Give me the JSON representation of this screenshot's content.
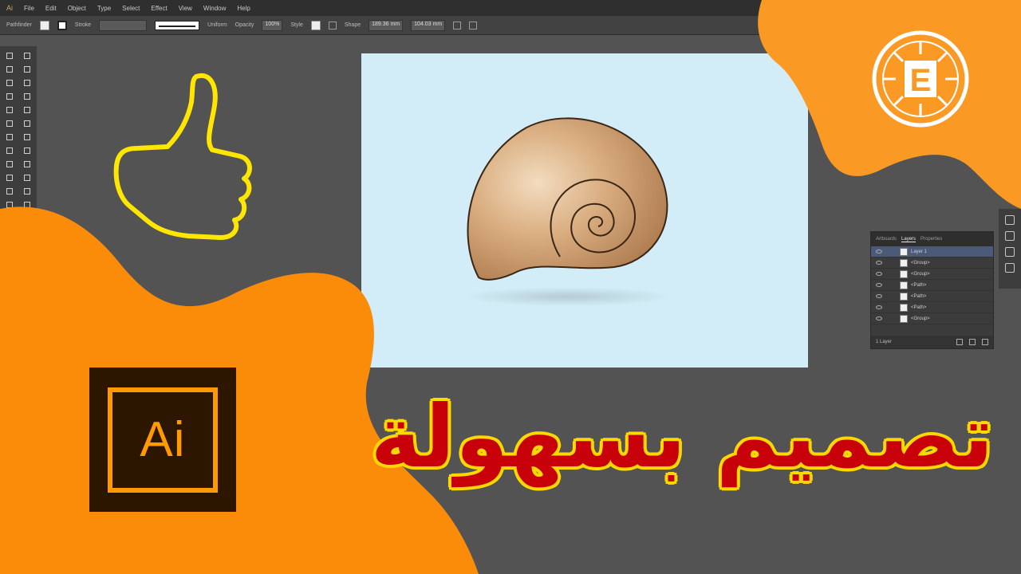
{
  "menubar": {
    "app_badge": "Ai",
    "items": [
      "File",
      "Edit",
      "Object",
      "Type",
      "Select",
      "Effect",
      "View",
      "Window",
      "Help"
    ]
  },
  "controlbar": {
    "selection_label": "Pathfinder",
    "stroke_label": "Stroke",
    "uniform_label": "Uniform",
    "opacity_label": "Opacity",
    "opacity_value": "100%",
    "style_label": "Style",
    "shape_label": "Shape",
    "w_value": "189.36 mm",
    "h_value": "104.03 mm"
  },
  "layers_panel": {
    "tabs": [
      "Artboards",
      "Layers",
      "Properties"
    ],
    "active_tab": "Layers",
    "rows": [
      "Layer 1",
      "<Group>",
      "<Group>",
      "<Path>",
      "<Path>",
      "<Path>",
      "<Group>"
    ],
    "footer_count": "1 Layer"
  },
  "ai_logo": {
    "text": "Ai"
  },
  "brand_emblem": {
    "letter": "E"
  },
  "headline": {
    "text": "تصميم بسهولة"
  },
  "colors": {
    "orange": "#fb8c0a",
    "orange_light": "#fa9a25",
    "artboard": "#d2edf7",
    "headline_red": "#c8000a",
    "headline_outline": "#ffd800",
    "ai_dark": "#2c1600",
    "ai_orange": "#ff9a00",
    "thumb_outline": "#ffe600"
  }
}
